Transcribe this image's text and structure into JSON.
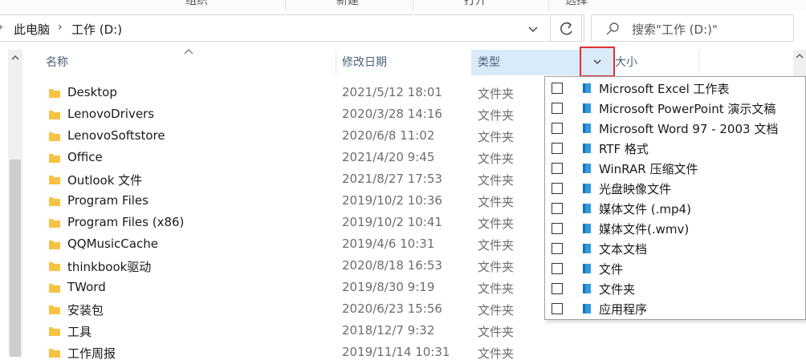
{
  "ribbon": {
    "groups": [
      "组织",
      "新建",
      "打开",
      "选择"
    ]
  },
  "address_bar": {
    "crumbs": [
      "此电脑",
      "工作 (D:)"
    ]
  },
  "search": {
    "placeholder": "搜索\"工作 (D:)\""
  },
  "columns": {
    "name": "名称",
    "date": "修改日期",
    "type": "类型",
    "size": "大小"
  },
  "files": [
    {
      "name": "Desktop",
      "date": "2021/5/12 18:01",
      "type": "文件夹"
    },
    {
      "name": "LenovoDrivers",
      "date": "2020/3/28 14:16",
      "type": "文件夹"
    },
    {
      "name": "LenovoSoftstore",
      "date": "2020/6/8 11:02",
      "type": "文件夹"
    },
    {
      "name": "Office",
      "date": "2021/4/20 9:45",
      "type": "文件夹"
    },
    {
      "name": "Outlook 文件",
      "date": "2021/8/27 17:53",
      "type": "文件夹"
    },
    {
      "name": "Program Files",
      "date": "2019/10/2 10:36",
      "type": "文件夹"
    },
    {
      "name": "Program Files (x86)",
      "date": "2019/10/2 10:41",
      "type": "文件夹"
    },
    {
      "name": "QQMusicCache",
      "date": "2019/4/6 10:31",
      "type": "文件夹"
    },
    {
      "name": "thinkbook驱动",
      "date": "2020/8/18 16:53",
      "type": "文件夹"
    },
    {
      "name": "TWord",
      "date": "2019/8/30 9:19",
      "type": "文件夹"
    },
    {
      "name": "安装包",
      "date": "2020/6/23 15:56",
      "type": "文件夹"
    },
    {
      "name": "工具",
      "date": "2018/12/7 9:32",
      "type": "文件夹"
    },
    {
      "name": "工作周报",
      "date": "2019/11/14 10:31",
      "type": "文件夹"
    }
  ],
  "filter_options": [
    "Microsoft Excel 工作表",
    "Microsoft PowerPoint 演示文稿",
    "Microsoft Word 97 - 2003 文档",
    "RTF 格式",
    "WinRAR 压缩文件",
    "光盘映像文件",
    "媒体文件 (.mp4)",
    "媒体文件(.wmv)",
    "文本文档",
    "文件",
    "文件夹",
    "应用程序"
  ],
  "colors": {
    "folder": "#f6c346",
    "filter_icon": "#2f9be0",
    "highlight_border": "#e03131",
    "header_active": "#d9ebf9"
  }
}
